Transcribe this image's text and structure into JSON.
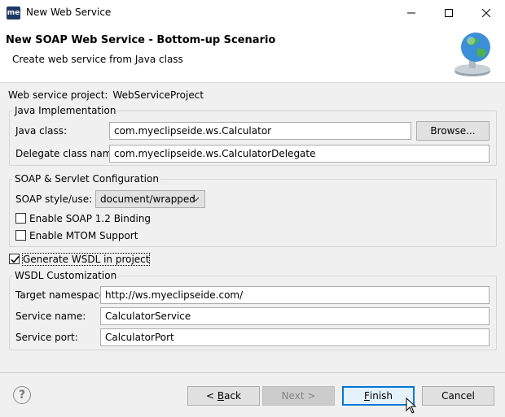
{
  "window": {
    "icon_text": "me",
    "title": "New Web Service"
  },
  "header": {
    "title": "New SOAP Web Service - Bottom-up Scenario",
    "subtitle": "Create web service from Java class"
  },
  "project": {
    "label": "Web service project:",
    "value": "WebServiceProject"
  },
  "java_impl": {
    "group_label": "Java Implementation",
    "java_class_label": "Java class:",
    "java_class_value": "com.myeclipseide.ws.Calculator",
    "browse_label": "Browse...",
    "delegate_label": "Delegate class name:",
    "delegate_value": "com.myeclipseide.ws.CalculatorDelegate"
  },
  "soap_config": {
    "group_label": "SOAP & Servlet Configuration",
    "style_label": "SOAP style/use:",
    "style_value": "document/wrapped",
    "soap12_label": "Enable SOAP 1.2 Binding",
    "soap12_checked": false,
    "mtom_label": "Enable MTOM Support",
    "mtom_checked": false
  },
  "generate_wsdl": {
    "label": "Generate WSDL in project",
    "checked": true
  },
  "wsdl": {
    "group_label": "WSDL Customization",
    "namespace_label": "Target namespace:",
    "namespace_value": "http://ws.myeclipseide.com/",
    "service_name_label": "Service name:",
    "service_name_value": "CalculatorService",
    "service_port_label": "Service port:",
    "service_port_value": "CalculatorPort"
  },
  "footer": {
    "help_label": "?",
    "back_prefix": "< ",
    "back_mnemonic": "B",
    "back_rest": "ack",
    "next_label": "Next >",
    "finish_mnemonic": "F",
    "finish_rest": "inish",
    "cancel_label": "Cancel"
  },
  "colors": {
    "accent": "#0078d7",
    "globe": "#3a8fd6",
    "land": "#4caf50"
  }
}
